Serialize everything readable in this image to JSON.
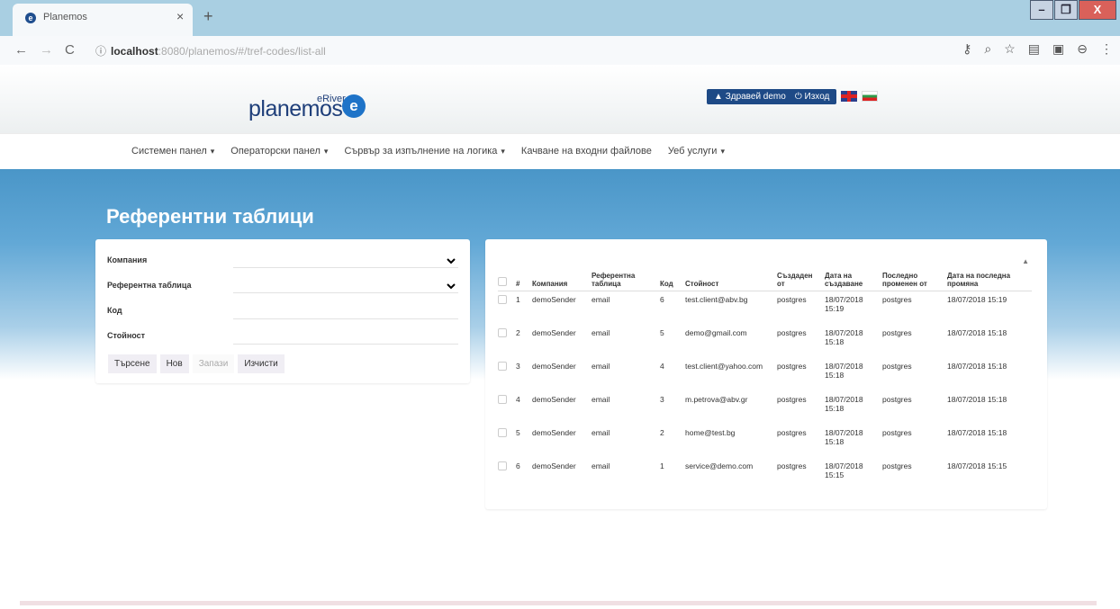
{
  "browser": {
    "tab_title": "Planemos",
    "tab_close": "×",
    "new_tab": "+",
    "url_host": "localhost",
    "url_rest": ":8080/planemos/#/tref-codes/list-all",
    "window_min": "–",
    "window_max": "❐",
    "window_close": "X"
  },
  "header": {
    "user_label": "Здравей demo",
    "logout_label": "Изход",
    "logo_text": "planemos",
    "logo_small": "eRiver",
    "logo_mark": "e"
  },
  "nav": {
    "items": [
      {
        "label": "Системен панел",
        "caret": "▾"
      },
      {
        "label": "Операторски панел",
        "caret": "▾"
      },
      {
        "label": "Сървър за изпълнение на логика",
        "caret": "▾"
      },
      {
        "label": "Качване на входни файлове",
        "caret": ""
      },
      {
        "label": "Уеб услуги",
        "caret": "▾"
      }
    ]
  },
  "page": {
    "title": "Референтни таблици"
  },
  "form": {
    "company_label": "Компания",
    "ref_table_label": "Референтна таблица",
    "code_label": "Код",
    "value_label": "Стойност",
    "buttons": {
      "search": "Търсене",
      "new": "Нов",
      "save": "Запази",
      "clear": "Изчисти"
    }
  },
  "table": {
    "headers": {
      "num": "#",
      "company": "Компания",
      "ref_table": "Референтна таблица",
      "code": "Код",
      "value": "Стойност",
      "created_by": "Създаден от",
      "created_at": "Дата на създаване",
      "modified_by": "Последно променен от",
      "modified_at": "Дата на последна промяна"
    },
    "rows": [
      {
        "num": "1",
        "company": "demoSender",
        "ref_table": "email",
        "code": "6",
        "value": "test.client@abv.bg",
        "created_by": "postgres",
        "created_at": "18/07/2018 15:19",
        "modified_by": "postgres",
        "modified_at": "18/07/2018 15:19"
      },
      {
        "num": "2",
        "company": "demoSender",
        "ref_table": "email",
        "code": "5",
        "value": "demo@gmail.com",
        "created_by": "postgres",
        "created_at": "18/07/2018 15:18",
        "modified_by": "postgres",
        "modified_at": "18/07/2018 15:18"
      },
      {
        "num": "3",
        "company": "demoSender",
        "ref_table": "email",
        "code": "4",
        "value": "test.client@yahoo.com",
        "created_by": "postgres",
        "created_at": "18/07/2018 15:18",
        "modified_by": "postgres",
        "modified_at": "18/07/2018 15:18"
      },
      {
        "num": "4",
        "company": "demoSender",
        "ref_table": "email",
        "code": "3",
        "value": "m.petrova@abv.gr",
        "created_by": "postgres",
        "created_at": "18/07/2018 15:18",
        "modified_by": "postgres",
        "modified_at": "18/07/2018 15:18"
      },
      {
        "num": "5",
        "company": "demoSender",
        "ref_table": "email",
        "code": "2",
        "value": "home@test.bg",
        "created_by": "postgres",
        "created_at": "18/07/2018 15:18",
        "modified_by": "postgres",
        "modified_at": "18/07/2018 15:18"
      },
      {
        "num": "6",
        "company": "demoSender",
        "ref_table": "email",
        "code": "1",
        "value": "service@demo.com",
        "created_by": "postgres",
        "created_at": "18/07/2018 15:15",
        "modified_by": "postgres",
        "modified_at": "18/07/2018 15:15"
      }
    ]
  },
  "colors": {
    "accent": "#1e4a86",
    "hero_top": "#4a96c8",
    "tabbar": "#a9cfe2"
  }
}
